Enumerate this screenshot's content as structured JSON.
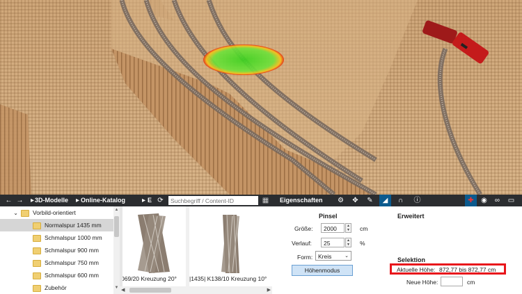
{
  "toolbar": {
    "breadcrumb": [
      "3D-Modelle",
      "Online-Katalog",
      "E"
    ],
    "search_placeholder": "Suchbegriff / Content-ID",
    "panel_title": "Eigenschaften"
  },
  "tree": {
    "items": [
      {
        "label": "Vorbild-orientiert",
        "level": 0,
        "expanded": true
      },
      {
        "label": "Normalspur 1435 mm",
        "level": 1,
        "selected": true
      },
      {
        "label": "Schmalspur 1000 mm",
        "level": 1
      },
      {
        "label": "Schmalspur 900 mm",
        "level": 1
      },
      {
        "label": "Schmalspur 750 mm",
        "level": 1
      },
      {
        "label": "Schmalspur 600 mm",
        "level": 1
      },
      {
        "label": "Zubehör",
        "level": 1
      }
    ]
  },
  "catalog": {
    "items": [
      {
        "caption": "069/20 Kreuzung 20°"
      },
      {
        "caption": "|1435| K138/10 Kreuzung 10°"
      }
    ]
  },
  "pinsel": {
    "title": "Pinsel",
    "groesse_label": "Größe:",
    "groesse_value": "2000",
    "groesse_unit": "cm",
    "verlauf_label": "Verlauf:",
    "verlauf_value": "25",
    "verlauf_unit": "%",
    "form_label": "Form:",
    "form_value": "Kreis",
    "button": "Höhenmodus"
  },
  "erweitert": {
    "title": "Erweitert"
  },
  "selektion": {
    "title": "Selektion",
    "aktuelle_label": "Aktuelle Höhe:",
    "aktuelle_value": "872,77 bis 872,77 cm",
    "neue_label": "Neue Höhe:",
    "neue_value": "",
    "neue_unit": "cm"
  },
  "colors": {
    "toolbar": "#2b2d30",
    "highlight": "#e8151b",
    "selected_row": "#d6d6d6"
  }
}
